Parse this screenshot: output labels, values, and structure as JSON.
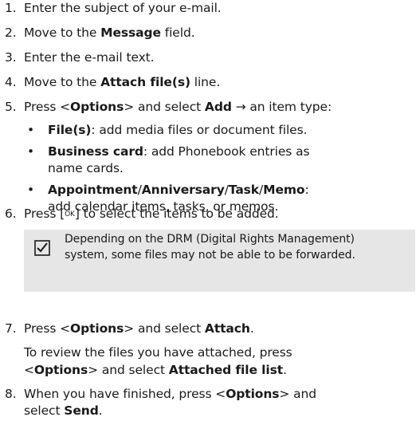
{
  "steps": {
    "s1": {
      "num": "1.",
      "text": "Enter the subject of your e-mail."
    },
    "s2": {
      "num": "2.",
      "pre": "Move to the ",
      "bold": "Message",
      "post": " field."
    },
    "s3": {
      "num": "3.",
      "text": "Enter the e-mail text."
    },
    "s4": {
      "num": "4.",
      "pre": "Move to the ",
      "bold": "Attach file(s)",
      "post": " line."
    },
    "s5": {
      "num": "5.",
      "pre": "Press <",
      "bold1": "Options",
      "mid": "> and select ",
      "bold2": "Add",
      "post": " → an item type:"
    },
    "s6": {
      "num": "6.",
      "pre": "Press [",
      "key": "OK",
      "post": "] to select the items to be added."
    },
    "s7": {
      "num": "7.",
      "pre": "Press <",
      "bold1": "Options",
      "mid": "> and select ",
      "bold2": "Attach",
      "post": "."
    },
    "s8": {
      "num": "8.",
      "pre": "When you have finished, press <",
      "bold1": "Options",
      "post": "> and",
      "line2_pre": "select ",
      "line2_bold": "Send",
      "line2_post": "."
    }
  },
  "bullets": {
    "b1": {
      "dot": "•",
      "bold": "File(s)",
      "post": ": add media files or document files."
    },
    "b2": {
      "dot": "•",
      "bold": "Business card",
      "post": ": add Phonebook entries as",
      "line2": "name cards."
    },
    "b3": {
      "dot": "•",
      "bold1": "Appointment",
      "sep1": "/",
      "bold2": "Anniversary",
      "sep2": "/",
      "bold3": "Task",
      "sep3": "/",
      "bold4": "Memo",
      "post": ":",
      "line2": "add calendar items, tasks, or memos."
    }
  },
  "note": {
    "icon": "checkbox-note-icon",
    "text": "Depending on the DRM (Digital Rights Management) system, some files may not be able to be forwarded."
  },
  "review": {
    "line1": "To review the files you have attached, press",
    "pre": "<",
    "bold1": "Options",
    "mid": "> and select ",
    "bold2": "Attached file list",
    "post": "."
  }
}
